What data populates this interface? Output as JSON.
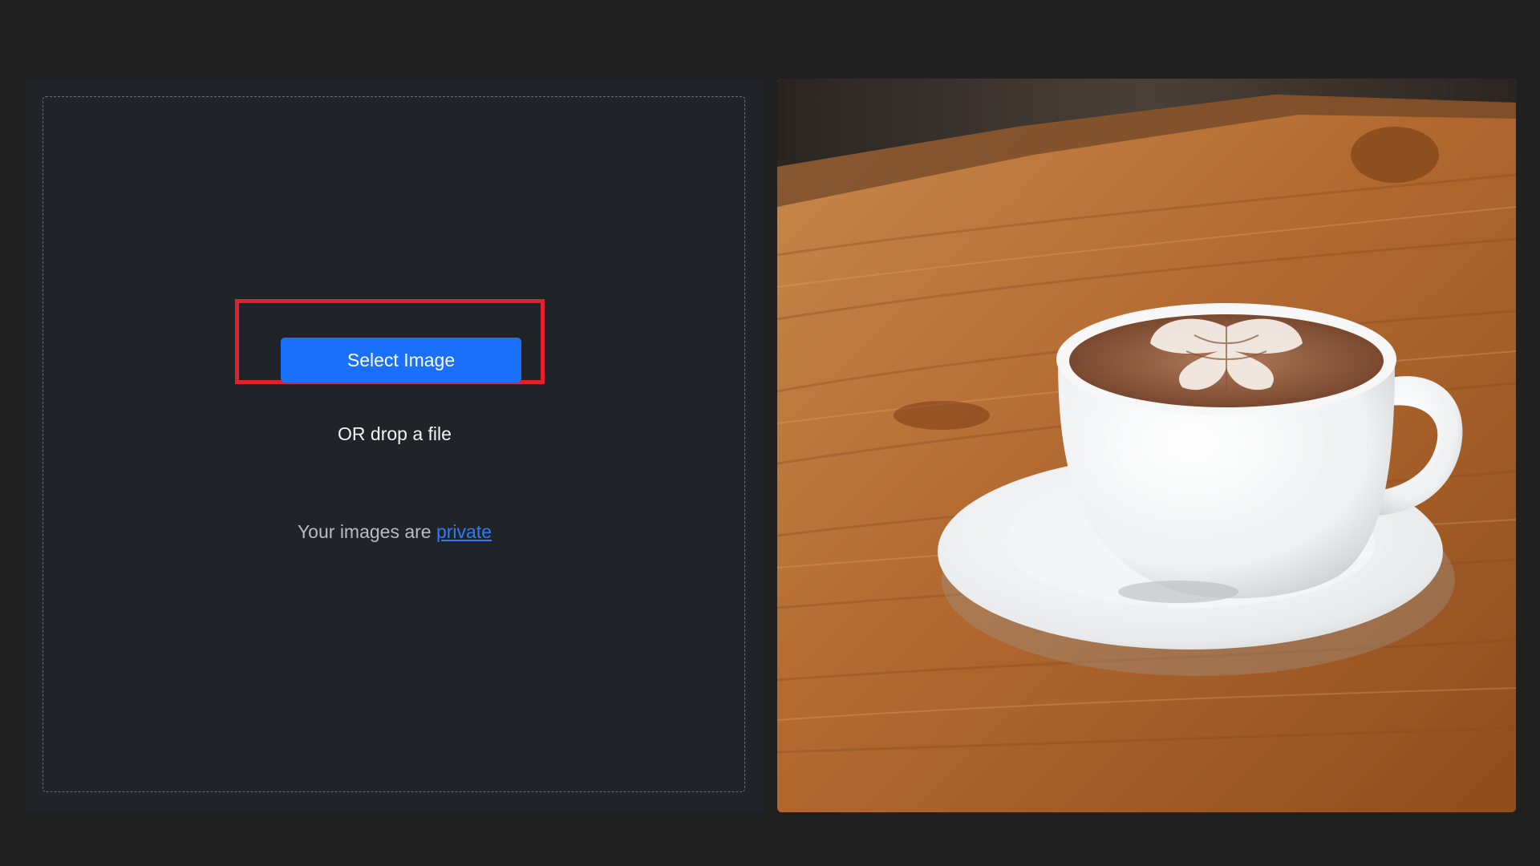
{
  "upload": {
    "button_label": "Select Image",
    "drop_text": "OR drop a file",
    "privacy_prefix": "Your images are ",
    "privacy_link_label": "private"
  },
  "preview": {
    "subject": "cup of latte with leaf latte art on a saucer on a wooden table"
  },
  "colors": {
    "page_background": "#202020",
    "panel_background": "#202328",
    "button": "#1a6ffb",
    "highlight": "#e3202b",
    "link": "#2f7cf6"
  }
}
